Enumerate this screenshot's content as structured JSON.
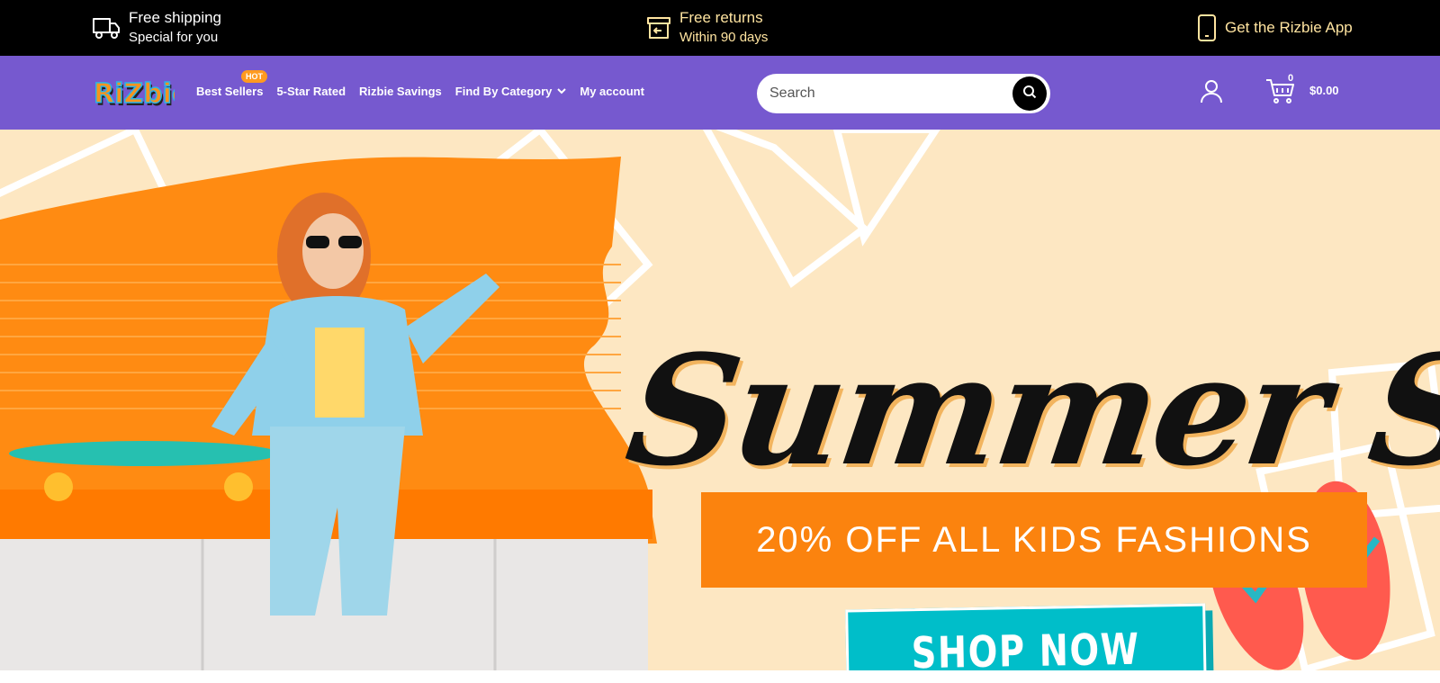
{
  "topbar": {
    "shipping": {
      "title": "Free shipping",
      "subtitle": "Special for you",
      "icon": "truck-icon"
    },
    "returns": {
      "title": "Free returns",
      "subtitle": "Within 90 days",
      "icon": "return-box-icon"
    },
    "app": {
      "title": "Get the Rizbie App",
      "icon": "phone-icon"
    }
  },
  "brand": {
    "logo_text": "RiZbie",
    "logo_colors": [
      "#f7941d",
      "#2bb3e8"
    ]
  },
  "nav": {
    "items": [
      {
        "label": "Best Sellers",
        "badge": "HOT"
      },
      {
        "label": "5-Star Rated"
      },
      {
        "label": "Rizbie Savings"
      },
      {
        "label": "Find By Category",
        "has_dropdown": true
      },
      {
        "label": "My account"
      }
    ]
  },
  "search": {
    "placeholder": "Search",
    "value": ""
  },
  "cart": {
    "count": "0",
    "total": "$0.00"
  },
  "hero": {
    "headline": "Summer Sale.",
    "offer": "20% OFF ALL KIDS FASHIONS",
    "cta": "SHOP NOW"
  },
  "colors": {
    "topbar_bg": "#000000",
    "nav_bg": "#7659cf",
    "accent_text": "#ffe4a0",
    "hot_badge": "#ff9a1f",
    "hero_bg": "#fde7c2",
    "offer_bg": "#fb830e",
    "cta_bg": "#00bec9"
  }
}
